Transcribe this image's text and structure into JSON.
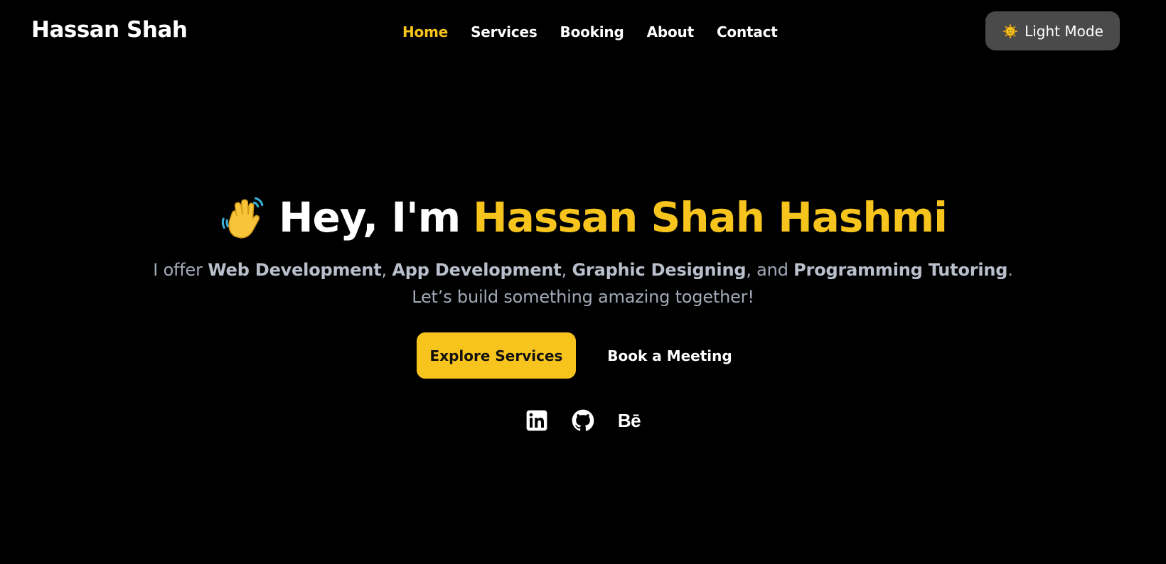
{
  "header": {
    "brand": "Hassan Shah",
    "nav": [
      {
        "label": "Home",
        "active": true
      },
      {
        "label": "Services",
        "active": false
      },
      {
        "label": "Booking",
        "active": false
      },
      {
        "label": "About",
        "active": false
      },
      {
        "label": "Contact",
        "active": false
      }
    ],
    "theme_toggle": {
      "icon": "sun-icon",
      "label": "Light Mode"
    }
  },
  "hero": {
    "icon": "waving-hand-icon",
    "greeting": "Hey, I'm",
    "name": "Hassan Shah Hashmi",
    "subtitle": {
      "prefix": "I offer",
      "services": [
        "Web Development",
        "App Development",
        "Graphic Designing",
        "Programming Tutoring"
      ],
      "sep1": ",",
      "sep2": ",",
      "sep3": ", and",
      "suffix": ". Let’s build something amazing together!"
    },
    "primary_cta": "Explore Services",
    "secondary_cta": "Book a Meeting"
  },
  "socials": [
    {
      "name": "linkedin-icon"
    },
    {
      "name": "github-icon"
    },
    {
      "name": "behance-icon",
      "text": "Bē"
    }
  ],
  "colors": {
    "background": "#000000",
    "accent": "#f6c41c",
    "toggle_bg": "#4a4a4a",
    "subtitle": "#a2aab8"
  }
}
